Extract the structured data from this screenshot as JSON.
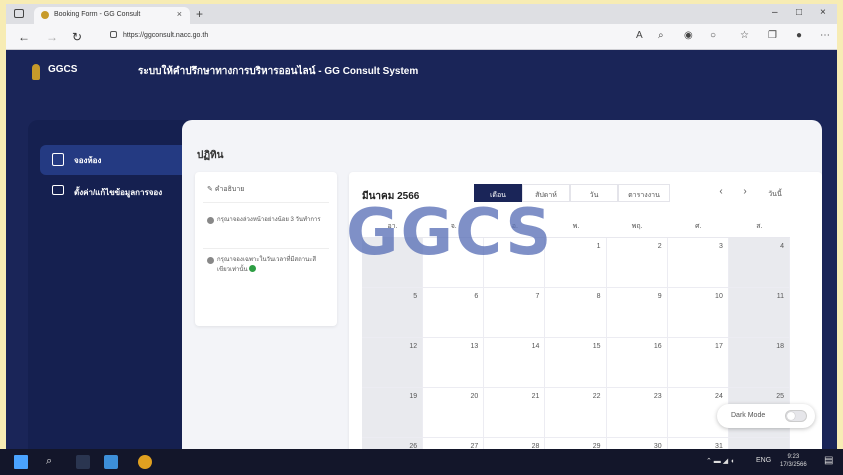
{
  "browser": {
    "tab_title": "Booking Form - GG Consult",
    "url": "https://ggconsult.nacc.go.th",
    "new_tab_symbol": "+",
    "tab_close_symbol": "×",
    "minimize_symbol": "–",
    "maximize_symbol": "□",
    "close_symbol": "×"
  },
  "header": {
    "brand": "GGCS",
    "title": "ระบบให้คำปรึกษาทางการบริหารออนไลน์ - GG Consult System"
  },
  "sidebar": {
    "items": [
      {
        "label": "จองห้อง"
      },
      {
        "label": "ตั้งค่า/แก้ไขข้อมูลการจอง"
      }
    ]
  },
  "main": {
    "page_title": "ปฏิทิน",
    "description": {
      "heading": "คำอธิบาย",
      "items": [
        "กรุณาจองล่วงหน้าอย่างน้อย 3 วันทำการ",
        "กรุณาจองเฉพาะในวันเวลาที่มีสถานะสีเขียวเท่านั้น"
      ]
    },
    "calendar": {
      "month": "มีนาคม 2566",
      "views": [
        "เดือน",
        "สัปดาห์",
        "วัน",
        "ตารางงาน"
      ],
      "active_view": "เดือน",
      "prev": "‹",
      "next": "›",
      "today": "วันนี้",
      "weekdays": [
        "อา.",
        "จ.",
        "อ.",
        "พ.",
        "พฤ.",
        "ศ.",
        "ส."
      ],
      "weeks": [
        [
          "",
          "",
          "",
          "1",
          "2",
          "3",
          "4"
        ],
        [
          "5",
          "6",
          "7",
          "8",
          "9",
          "10",
          "11"
        ],
        [
          "12",
          "13",
          "14",
          "15",
          "16",
          "17",
          "18"
        ],
        [
          "19",
          "20",
          "21",
          "22",
          "23",
          "24",
          "25"
        ],
        [
          "26",
          "27",
          "28",
          "29",
          "30",
          "31",
          ""
        ]
      ]
    },
    "watermark": "GGCS",
    "dark_mode_label": "Dark Mode",
    "dark_mode_on": false
  },
  "taskbar": {
    "lang": "ENG",
    "time": "9:23",
    "date": "17/3/2566"
  }
}
